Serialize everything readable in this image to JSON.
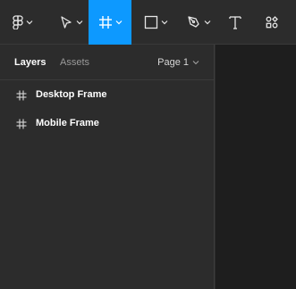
{
  "toolbar": {
    "tools": [
      {
        "name": "main-menu",
        "icon": "figma-logo-icon",
        "has_dropdown": true,
        "active": false
      },
      {
        "name": "move",
        "icon": "cursor-icon",
        "has_dropdown": true,
        "active": false
      },
      {
        "name": "frame",
        "icon": "frame-icon",
        "has_dropdown": true,
        "active": true
      },
      {
        "name": "shape",
        "icon": "rectangle-icon",
        "has_dropdown": true,
        "active": false
      },
      {
        "name": "pen",
        "icon": "pen-icon",
        "has_dropdown": true,
        "active": false
      },
      {
        "name": "text",
        "icon": "text-icon",
        "has_dropdown": false,
        "active": false
      },
      {
        "name": "resources",
        "icon": "resources-icon",
        "has_dropdown": false,
        "active": false
      }
    ],
    "active_color": "#0d99ff"
  },
  "left_panel": {
    "tabs": [
      {
        "label": "Layers",
        "active": true
      },
      {
        "label": "Assets",
        "active": false
      }
    ],
    "page_selector": {
      "label": "Page 1"
    },
    "layers": [
      {
        "label": "Desktop Frame",
        "icon": "frame-icon"
      },
      {
        "label": "Mobile Frame",
        "icon": "frame-icon"
      }
    ]
  },
  "colors": {
    "toolbar_bg": "#2c2c2c",
    "panel_bg": "#2c2c2c",
    "canvas_bg": "#1e1e1e",
    "accent": "#0d99ff"
  }
}
